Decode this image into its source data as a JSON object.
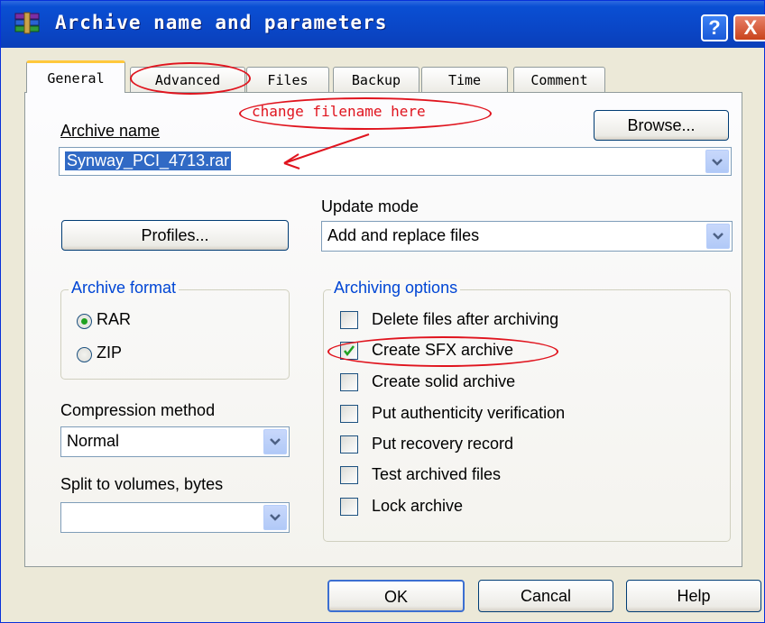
{
  "window": {
    "title": "Archive name and parameters",
    "help_button": "?",
    "close_button": "X"
  },
  "tabs": [
    {
      "label": "General",
      "active": true
    },
    {
      "label": "Advanced",
      "active": false
    },
    {
      "label": "Files",
      "active": false
    },
    {
      "label": "Backup",
      "active": false
    },
    {
      "label": "Time",
      "active": false
    },
    {
      "label": "Comment",
      "active": false
    }
  ],
  "annotation": {
    "note": "change filename here",
    "color": "#e0141e"
  },
  "archive_name": {
    "label": "Archive name",
    "value": "Synway_PCI_4713.rar",
    "browse_label": "Browse..."
  },
  "profiles_label": "Profiles...",
  "update_mode": {
    "label": "Update mode",
    "value": "Add and replace files"
  },
  "archive_format": {
    "title": "Archive format",
    "options": [
      {
        "label": "RAR",
        "selected": true
      },
      {
        "label": "ZIP",
        "selected": false
      }
    ]
  },
  "compression": {
    "label": "Compression method",
    "value": "Normal"
  },
  "split": {
    "label": "Split to volumes, bytes",
    "value": ""
  },
  "archiving_options": {
    "title": "Archiving options",
    "items": [
      {
        "label": "Delete files after archiving",
        "checked": false
      },
      {
        "label": "Create SFX archive",
        "checked": true
      },
      {
        "label": "Create solid archive",
        "checked": false
      },
      {
        "label": "Put authenticity verification",
        "checked": false
      },
      {
        "label": "Put recovery record",
        "checked": false
      },
      {
        "label": "Test archived files",
        "checked": false
      },
      {
        "label": "Lock archive",
        "checked": false
      }
    ]
  },
  "buttons": {
    "ok": "OK",
    "cancel": "Cancal",
    "help": "Help"
  },
  "colors": {
    "titlebar": "#0a47c8",
    "accent_text": "#0046d5",
    "selection": "#316ac5"
  }
}
